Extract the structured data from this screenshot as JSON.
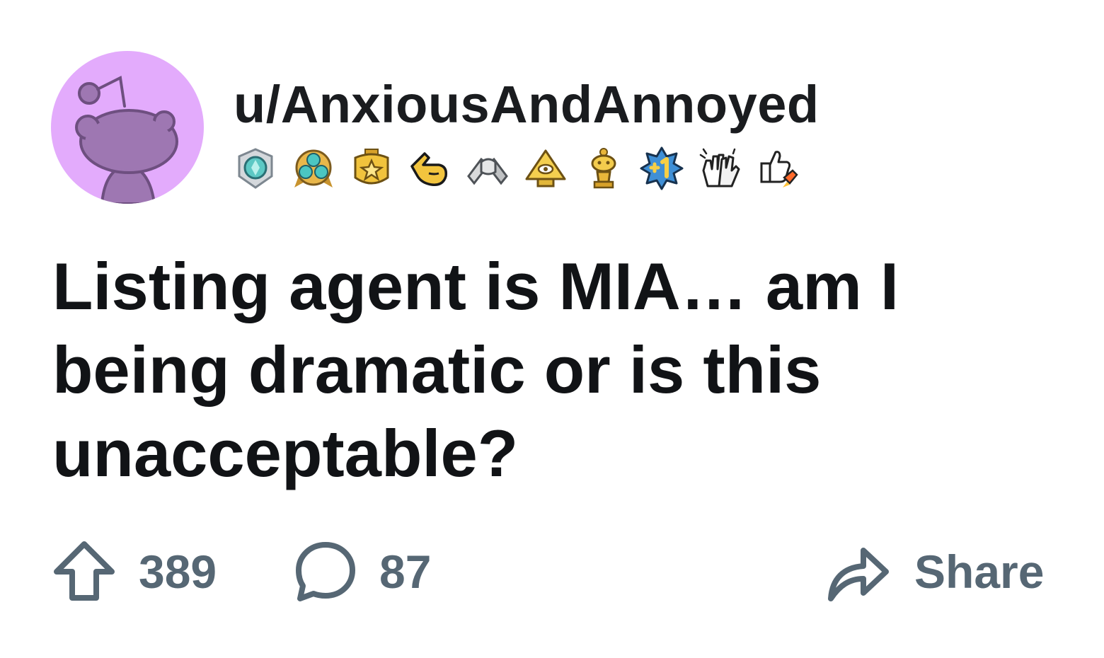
{
  "post": {
    "author": "u/AnxiousAndAnnoyed",
    "avatar_color": "#e3abfc",
    "trophies": [
      "gem-badge-icon",
      "triple-gem-badge-icon",
      "gold-star-badge-icon",
      "pointing-hand-icon",
      "handshake-icon",
      "pyramid-eye-icon",
      "gold-snoo-trophy-icon",
      "plus-one-badge-icon",
      "clapping-hands-icon",
      "thumbs-up-rocket-icon"
    ],
    "title": "Listing agent is MIA… am I being dramatic or is this unacceptable?",
    "upvotes": "389",
    "comments": "87",
    "share_label": "Share"
  },
  "colors": {
    "action_gray": "#566774",
    "title_text": "#111316"
  }
}
